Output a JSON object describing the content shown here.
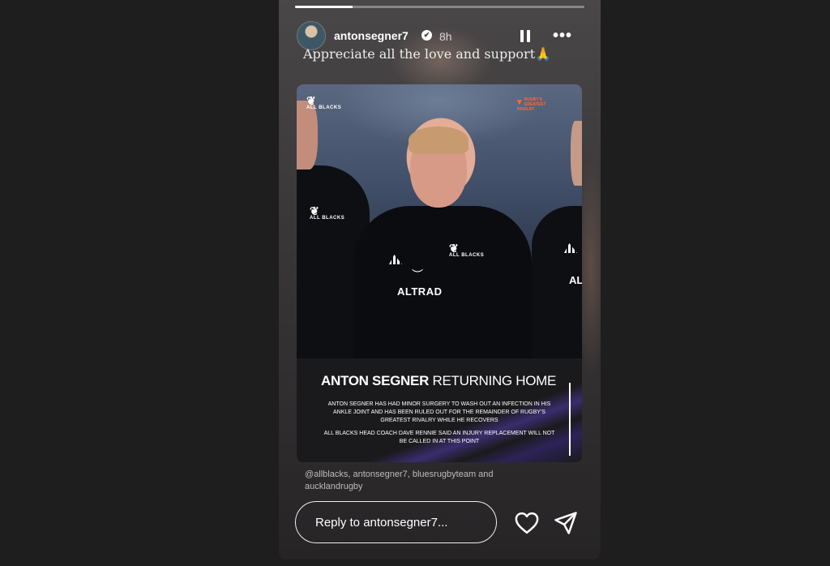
{
  "story": {
    "progress": 0.2,
    "user": {
      "username": "antonsegner7",
      "verified_glyph": "✔",
      "time_ago": "8h"
    },
    "controls": {
      "pause_icon": "pause-icon",
      "more_glyph": "•••"
    },
    "caption": "Appreciate all the love and support🙏"
  },
  "post": {
    "logos": {
      "all_blacks": "ALL BLACKS",
      "rivalry_line1": "RUGBY'S",
      "rivalry_line2": "GREATEST",
      "rivalry_line3": "RIVALRY",
      "chest": "ALL BLACKS",
      "sponsor": "ALTRAD",
      "sponsor_partial": "AL"
    },
    "headline_strong": "ANTON SEGNER",
    "headline_rest": " RETURNING HOME",
    "paragraph_1": "ANTON SEGNER HAS HAD MINOR SURGERY TO WASH OUT AN INFECTION IN HIS ANKLE JOINT AND HAS BEEN RULED OUT FOR THE REMAINDER OF RUGBY'S GREATEST RIVALRY WHILE HE RECOVERS",
    "paragraph_2": "ALL BLACKS HEAD COACH DAVE RENNIE SAID AN INJURY REPLACEMENT WILL NOT BE CALLED IN AT THIS POINT"
  },
  "mentions": "@allblacks, antonsegner7, bluesrugbyteam and aucklandrugby",
  "reply": {
    "placeholder": "Reply to antonsegner7..."
  },
  "icons": {
    "like": "heart-icon",
    "share": "send-icon"
  },
  "colors": {
    "page_background": "#1e1e1e",
    "rivalry_orange": "#ff6a2a",
    "accent_purple": "#3b2d6e"
  }
}
